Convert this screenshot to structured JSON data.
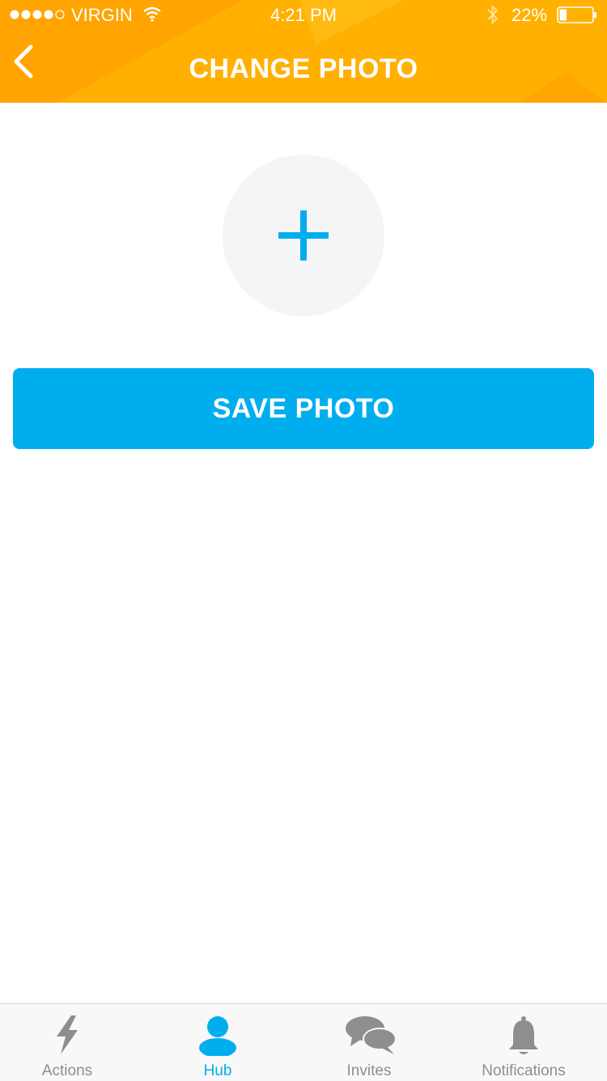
{
  "status_bar": {
    "carrier": "VIRGIN",
    "time": "4:21 PM",
    "battery_percent": "22%",
    "signal_bars_filled": 4,
    "signal_bars_total": 5,
    "battery_level": 0.22
  },
  "header": {
    "title": "CHANGE PHOTO",
    "back_icon": "chevron-left-icon",
    "background_color": "#FFB000"
  },
  "photo_picker": {
    "icon": "plus-icon",
    "accent_color": "#00AEEE"
  },
  "save_button": {
    "label": "SAVE PHOTO",
    "color": "#00AEEE"
  },
  "tab_bar": {
    "active_tab": "Hub",
    "active_color": "#00AEEE",
    "inactive_color": "#8E8E8E",
    "tabs": [
      {
        "label": "Actions",
        "icon": "lightning-icon"
      },
      {
        "label": "Hub",
        "icon": "person-icon"
      },
      {
        "label": "Invites",
        "icon": "chat-bubbles-icon"
      },
      {
        "label": "Notifications",
        "icon": "bell-icon"
      }
    ]
  }
}
